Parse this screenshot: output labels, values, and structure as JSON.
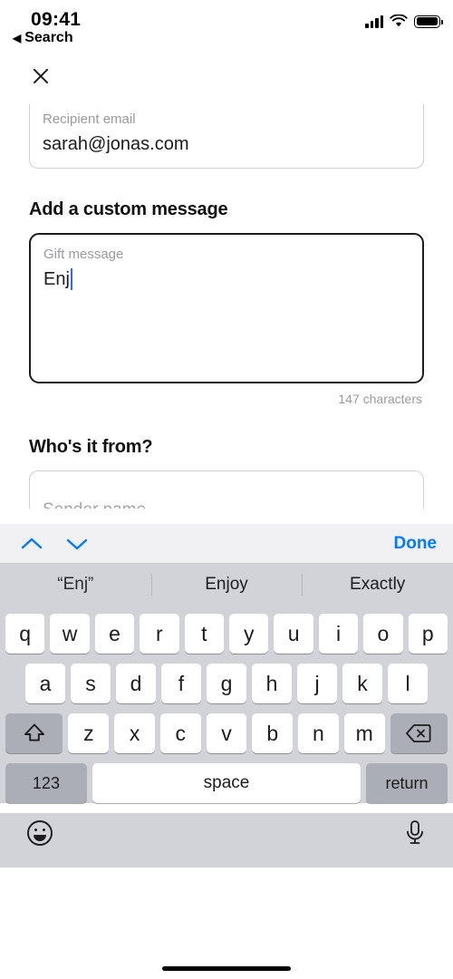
{
  "status_bar": {
    "time": "09:41",
    "back_label": "Search",
    "back_arrow": "◀",
    "icons": [
      "cellular-signal-icon",
      "wifi-icon",
      "battery-icon"
    ]
  },
  "nav": {
    "close_label": "close-icon"
  },
  "form": {
    "recipient": {
      "label": "Recipient email",
      "value": "sarah@jonas.com"
    },
    "message_section_title": "Add a custom message",
    "gift_message": {
      "label": "Gift message",
      "value": "Enj",
      "focused": true,
      "caret_color": "#2f6bf0"
    },
    "char_counter": "147 characters",
    "sender_section_title": "Who's it from?",
    "sender": {
      "label": "Sender name",
      "value": ""
    }
  },
  "keyboard_accessory": {
    "prev_icon": "chevron-up-icon",
    "next_icon": "chevron-down-icon",
    "done_label": "Done",
    "accent_color": "#007aff"
  },
  "suggestions": [
    "“Enj”",
    "Enjoy",
    "Exactly"
  ],
  "keyboard": {
    "row1": [
      "q",
      "w",
      "e",
      "r",
      "t",
      "y",
      "u",
      "i",
      "o",
      "p"
    ],
    "row2": [
      "a",
      "s",
      "d",
      "f",
      "g",
      "h",
      "j",
      "k",
      "l"
    ],
    "row3": [
      "z",
      "x",
      "c",
      "v",
      "b",
      "n",
      "m"
    ],
    "shift_icon": "shift-icon",
    "backspace_icon": "backspace-icon",
    "numeric_label": "123",
    "space_label": "space",
    "return_label": "return",
    "emoji_icon": "emoji-icon",
    "dictation_icon": "microphone-icon",
    "key_bg": "#ffffff",
    "fn_key_bg": "#abaeb6",
    "keyboard_bg": "#d1d3d9"
  }
}
